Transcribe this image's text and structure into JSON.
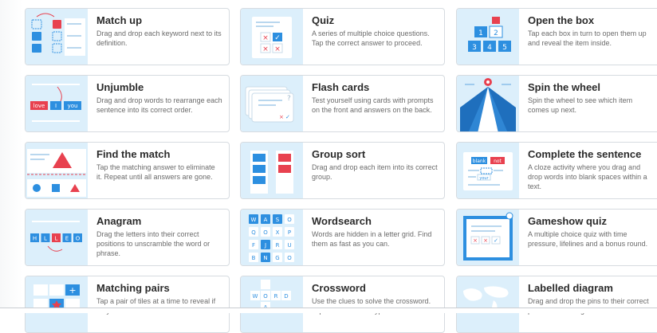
{
  "templates": [
    {
      "id": "match-up",
      "title": "Match up",
      "desc": "Drag and drop each keyword next to its definition."
    },
    {
      "id": "quiz",
      "title": "Quiz",
      "desc": "A series of multiple choice questions. Tap the correct answer to proceed."
    },
    {
      "id": "open-the-box",
      "title": "Open the box",
      "desc": "Tap each box in turn to open them up and reveal the item inside."
    },
    {
      "id": "unjumble",
      "title": "Unjumble",
      "desc": "Drag and drop words to rearrange each sentence into its correct order."
    },
    {
      "id": "flash-cards",
      "title": "Flash cards",
      "desc": "Test yourself using cards with prompts on the front and answers on the back."
    },
    {
      "id": "spin-the-wheel",
      "title": "Spin the wheel",
      "desc": "Spin the wheel to see which item comes up next."
    },
    {
      "id": "find-the-match",
      "title": "Find the match",
      "desc": "Tap the matching answer to eliminate it. Repeat until all answers are gone."
    },
    {
      "id": "group-sort",
      "title": "Group sort",
      "desc": "Drag and drop each item into its correct group."
    },
    {
      "id": "complete-the-sentence",
      "title": "Complete the sentence",
      "desc": "A cloze activity where you drag and drop words into blank spaces within a text."
    },
    {
      "id": "anagram",
      "title": "Anagram",
      "desc": "Drag the letters into their correct positions to unscramble the word or phrase."
    },
    {
      "id": "wordsearch",
      "title": "Wordsearch",
      "desc": "Words are hidden in a letter grid. Find them as fast as you can."
    },
    {
      "id": "gameshow-quiz",
      "title": "Gameshow quiz",
      "desc": "A multiple choice quiz with time pressure, lifelines and a bonus round."
    },
    {
      "id": "matching-pairs",
      "title": "Matching pairs",
      "desc": "Tap a pair of tiles at a time to reveal if they are a match."
    },
    {
      "id": "crossword",
      "title": "Crossword",
      "desc": "Use the clues to solve the crossword. Tap on a word and type in the answer."
    },
    {
      "id": "labelled-diagram",
      "title": "Labelled diagram",
      "desc": "Drag and drop the pins to their correct place on the image."
    }
  ],
  "thumb_text": {
    "unjumble_words": [
      "love",
      "I",
      "you"
    ],
    "open_box_numbers": [
      "1",
      "2",
      "3",
      "4",
      "5"
    ],
    "anagram_letters": [
      "H",
      "L",
      "L",
      "E",
      "O"
    ],
    "wordsearch_letters": [
      "W",
      "A",
      "S",
      "O",
      "Q",
      "O",
      "X",
      "P",
      "F",
      "J",
      "R",
      "U",
      "B",
      "N",
      "G",
      "O"
    ],
    "crossword_letters": [
      "W",
      "O",
      "R",
      "D",
      "A"
    ],
    "cloze_words": [
      "blank",
      "not",
      "your"
    ]
  },
  "colors": {
    "thumb_bg": "#dceffb",
    "blue": "#2d8fe0",
    "red": "#e8414f",
    "border": "#d6dbe0"
  }
}
